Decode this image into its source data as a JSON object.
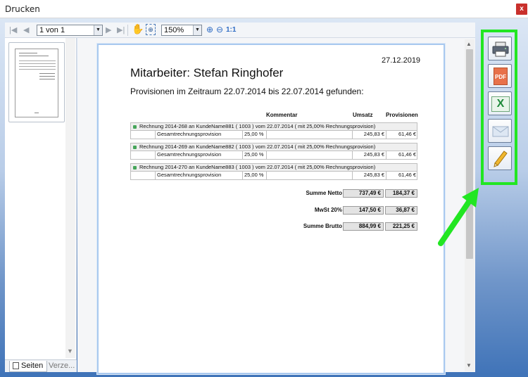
{
  "window": {
    "title": "Drucken",
    "close_label": "x"
  },
  "toolbar": {
    "page_value": "1 von 1",
    "zoom_value": "150%",
    "actual_size_label": "1:1"
  },
  "thumbnails": {
    "tabs": [
      {
        "label": "Seiten",
        "active": true
      },
      {
        "label": "Verze...",
        "active": false
      }
    ]
  },
  "report": {
    "date": "27.12.2019",
    "employee_title": "Mitarbeiter: Stefan Ringhofer",
    "subtitle": "Provisionen im Zeitraum 22.07.2014 bis 22.07.2014 gefunden:",
    "columns": {
      "comment": "Kommentar",
      "revenue": "Umsatz",
      "commission": "Provisionen"
    },
    "invoices": [
      {
        "text": "Rechnung 2014-268 an KundeName881 ( 1003 ) vom 22.07.2014 ( mit 25,00% Rechnungsprovision)",
        "detail_label": "Gesamtrechnungsprovision",
        "percent": "25,00 %",
        "comment": "",
        "revenue": "245,83 €",
        "commission": "61,46 €"
      },
      {
        "text": "Rechnung 2014-269 an KundeName882 ( 1003 ) vom 22.07.2014 ( mit 25,00% Rechnungsprovision)",
        "detail_label": "Gesamtrechnungsprovision",
        "percent": "25,00 %",
        "comment": "",
        "revenue": "245,83 €",
        "commission": "61,46 €"
      },
      {
        "text": "Rechnung 2014-270 an KundeName883 ( 1003 ) vom 22.07.2014 ( mit 25,00% Rechnungsprovision)",
        "detail_label": "Gesamtrechnungsprovision",
        "percent": "25,00 %",
        "comment": "",
        "revenue": "245,83 €",
        "commission": "61,46 €"
      }
    ],
    "totals": [
      {
        "label": "Summe Netto",
        "revenue": "737,49 €",
        "commission": "184,37 €"
      },
      {
        "label": "MwSt 20%",
        "revenue": "147,50 €",
        "commission": "36,87 €"
      },
      {
        "label": "Summe Brutto",
        "revenue": "884,99 €",
        "commission": "221,25 €"
      }
    ]
  },
  "actions": {
    "items": [
      {
        "icon": "printer-icon",
        "text": ""
      },
      {
        "icon": "pdf-icon",
        "text": "PDF"
      },
      {
        "icon": "excel-icon",
        "text": "X"
      },
      {
        "icon": "email-icon",
        "text": ""
      },
      {
        "icon": "pencil-icon",
        "text": ""
      }
    ],
    "highlight_color": "#22e622"
  },
  "colors": {
    "accent": "#22e622",
    "close": "#c9302c"
  }
}
